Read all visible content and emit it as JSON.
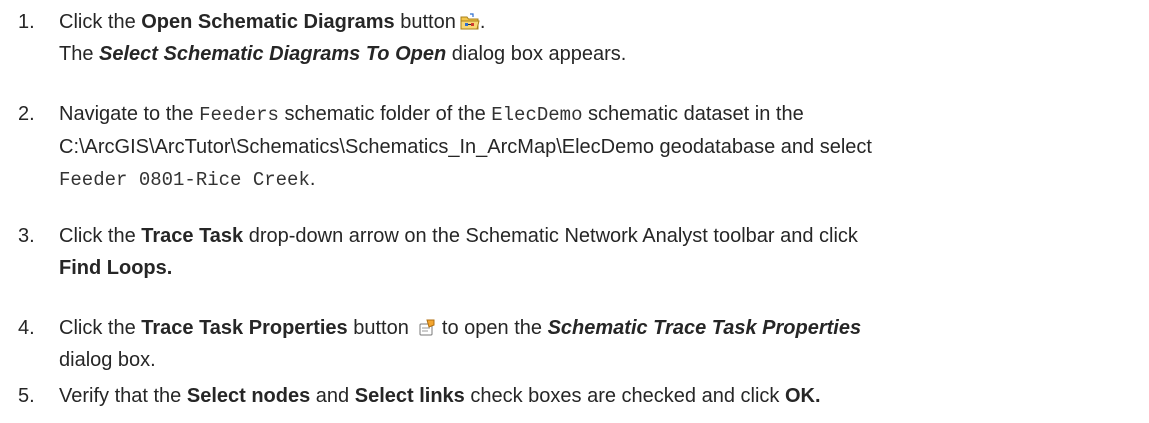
{
  "steps": [
    {
      "number": "1.",
      "prefix": "Click the ",
      "button": "Open Schematic Diagrams",
      "after_button": " button",
      "icon": "open-schematic-diagrams-icon",
      "end": ".",
      "line2_prefix": "The ",
      "dialog": "Select Schematic Diagrams To Open",
      "line2_suffix": " dialog box appears."
    },
    {
      "number": "2.",
      "text1": "Navigate to the ",
      "folder": "Feeders",
      "text2": " schematic folder of the ",
      "dataset": "ElecDemo",
      "text3": " schematic dataset in the",
      "path_line": "C:\\ArcGIS\\ArcTutor\\Schematics\\Schematics_In_ArcMap\\ElecDemo geodatabase and select",
      "diagram": "Feeder 0801-Rice Creek",
      "end": "."
    },
    {
      "number": "3.",
      "text1": "Click the ",
      "task": "Trace Task",
      "text2": " drop-down arrow on the Schematic Network Analyst toolbar and click",
      "command": "Find Loops."
    },
    {
      "number": "4.",
      "text1": "Click the ",
      "button": "Trace Task Properties",
      "text2": " button ",
      "icon": "trace-task-properties-icon",
      "text3": " to open the ",
      "dialog": "Schematic Trace Task Properties",
      "line2": "dialog box."
    },
    {
      "number": "5.",
      "text1": "Verify that the ",
      "option1": "Select nodes",
      "text2": " and ",
      "option2": "Select links",
      "text3": " check boxes are checked and click ",
      "button": "OK."
    }
  ]
}
